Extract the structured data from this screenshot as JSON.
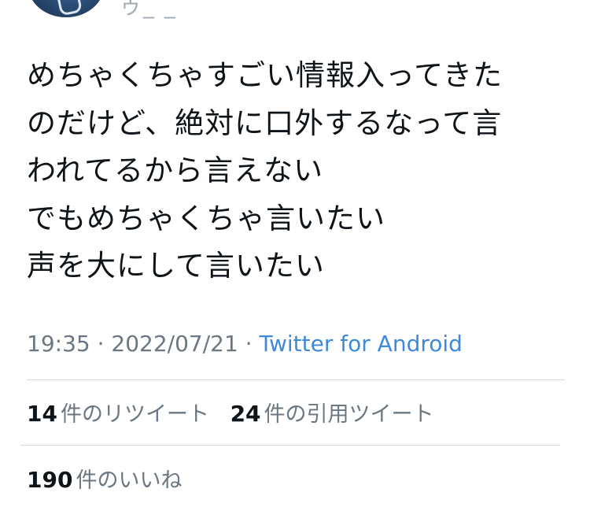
{
  "author": {
    "handle_fragment": "ゥ_  _"
  },
  "tweet": {
    "lines": [
      "めちゃくちゃすごい情報入ってきた",
      "のだけど、絶対に口外するなって言",
      "われてるから言えない",
      "でもめちゃくちゃ言いたい",
      "声を大にして言いたい"
    ],
    "time": "19:35",
    "separator": "·",
    "date": "2022/07/21",
    "source": "Twitter for Android"
  },
  "stats": {
    "retweets_count": "14",
    "retweets_label": "件のリツイート",
    "quotes_count": "24",
    "quotes_label": "件の引用ツイート",
    "likes_count": "190",
    "likes_label": "件のいいね"
  },
  "colors": {
    "text": "#0f1419",
    "secondary": "#6b7782",
    "link": "#3e8ad9",
    "divider": "#d6dbe0"
  }
}
